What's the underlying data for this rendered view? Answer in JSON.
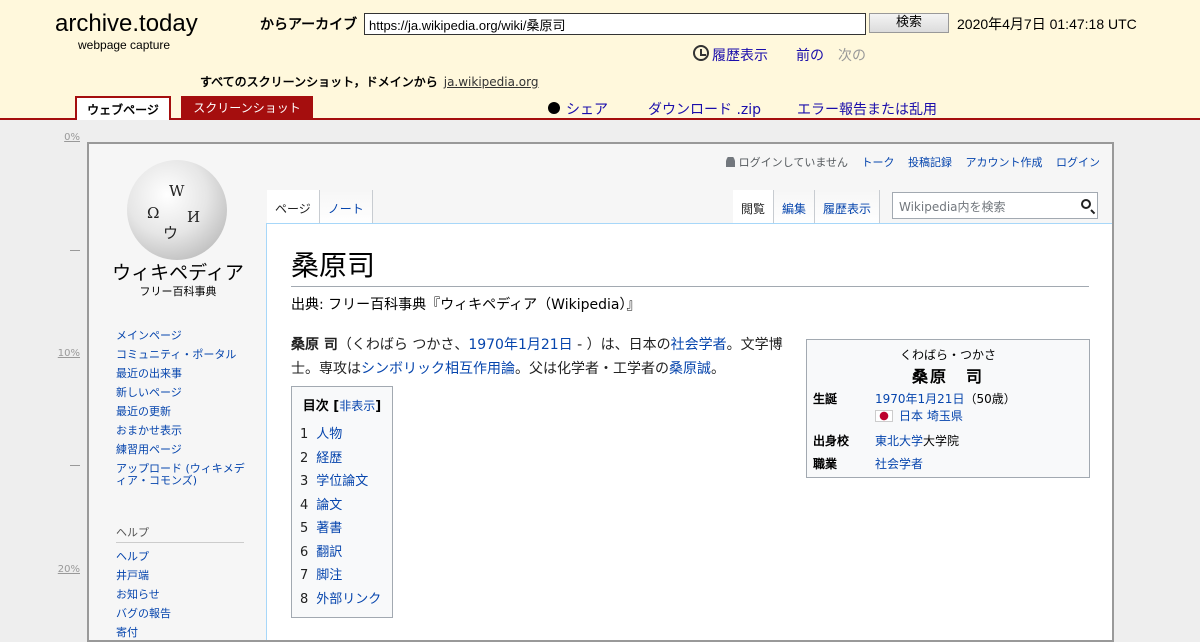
{
  "archive": {
    "brand": "archive.today",
    "brand_sub": "webpage capture",
    "archive_label": "からアーカイブ",
    "url_value": "https://ja.wikipedia.org/wiki/桑原司",
    "search_button": "検索",
    "date": "2020年4月7日 01:47:18 UTC",
    "history": "履歴表示",
    "prev": "前の",
    "next": "次の",
    "domain_text": "すべてのスクリーンショット，ドメインから",
    "domain_link": "ja.wikipedia.org",
    "tab_web": "ウェブページ",
    "tab_screenshot": "スクリーンショット",
    "share": "シェア",
    "download": "ダウンロード .zip",
    "report": "エラー報告または乱用"
  },
  "ruler": {
    "marks": [
      "0%",
      "10%",
      "20%"
    ]
  },
  "wiki": {
    "logo_title": "ウィキペディア",
    "logo_sub": "フリー百科事典",
    "nav": [
      "メインページ",
      "コミュニティ・ポータル",
      "最近の出来事",
      "新しいページ",
      "最近の更新",
      "おまかせ表示",
      "練習用ページ",
      "アップロード (ウィキメディア・コモンズ)"
    ],
    "help_heading": "ヘルプ",
    "help_nav": [
      "ヘルプ",
      "井戸端",
      "お知らせ",
      "バグの報告",
      "寄付"
    ],
    "personal": {
      "not_logged": "ログインしていません",
      "talk": "トーク",
      "contrib": "投稿記録",
      "create": "アカウント作成",
      "login": "ログイン"
    },
    "tabs_left": [
      "ページ",
      "ノート"
    ],
    "tabs_right": [
      "閲覧",
      "編集",
      "履歴表示"
    ],
    "search_placeholder": "Wikipedia内を検索",
    "title": "桑原司",
    "site_sub": "出典: フリー百科事典『ウィキペディア（Wikipedia）』",
    "lead": {
      "name": "桑原 司",
      "t1": "（くわばら つかさ、",
      "birth": "1970年1月21日",
      "t2": " - ）は、日本の",
      "sociologist": "社会学者",
      "t3": "。文学博士。専攻は",
      "symbolic": "シンボリック相互作用論",
      "t4": "。父は化学者・工学者の",
      "father": "桑原誠",
      "t5": "。"
    },
    "toc": {
      "title": "目次",
      "hide": "非表示",
      "items": [
        {
          "num": "1",
          "label": "人物"
        },
        {
          "num": "2",
          "label": "経歴"
        },
        {
          "num": "3",
          "label": "学位論文"
        },
        {
          "num": "4",
          "label": "論文"
        },
        {
          "num": "5",
          "label": "著書"
        },
        {
          "num": "6",
          "label": "翻訳"
        },
        {
          "num": "7",
          "label": "脚注"
        },
        {
          "num": "8",
          "label": "外部リンク"
        }
      ]
    },
    "infobox": {
      "kana": "くわばら・つかさ",
      "name": "桑原　司",
      "birth_label": "生誕",
      "birth_date": "1970年1月21日",
      "birth_age": "（50歳）",
      "birth_place": "日本 埼玉県",
      "school_label": "出身校",
      "school_link": "東北大学",
      "school_rest": "大学院",
      "job_label": "職業",
      "job": "社会学者"
    }
  }
}
